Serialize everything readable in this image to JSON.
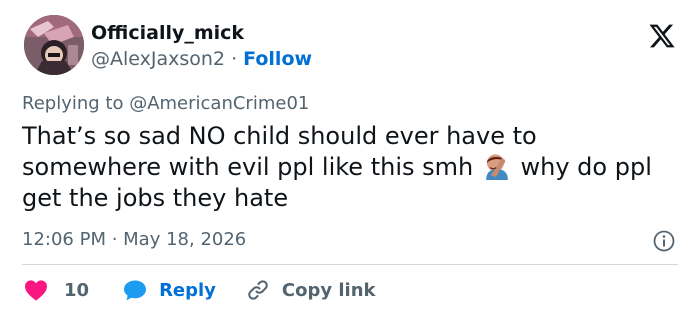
{
  "author": {
    "display_name": "Officially_mick",
    "handle": "@AlexJaxson2",
    "separator": " · ",
    "follow_label": "Follow"
  },
  "reply_context": {
    "prefix": "Replying to ",
    "mention": "@AmericanCrime01"
  },
  "tweet": {
    "text_before_emoji": "That’s so sad NO child should ever have to somewhere with evil ppl like this smh",
    "emoji_name": "face-palm-emoji",
    "text_after_emoji": "why do ppl get the jobs they hate"
  },
  "meta": {
    "time": "12:06 PM",
    "separator": " · ",
    "date": "May 18, 2026"
  },
  "actions": {
    "like_count": "10",
    "reply_label": "Reply",
    "copy_label": "Copy link"
  },
  "colors": {
    "heart": "#f91880",
    "reply_blue": "#1d9bf0",
    "link_blue": "#006fd6",
    "muted": "#536471"
  }
}
